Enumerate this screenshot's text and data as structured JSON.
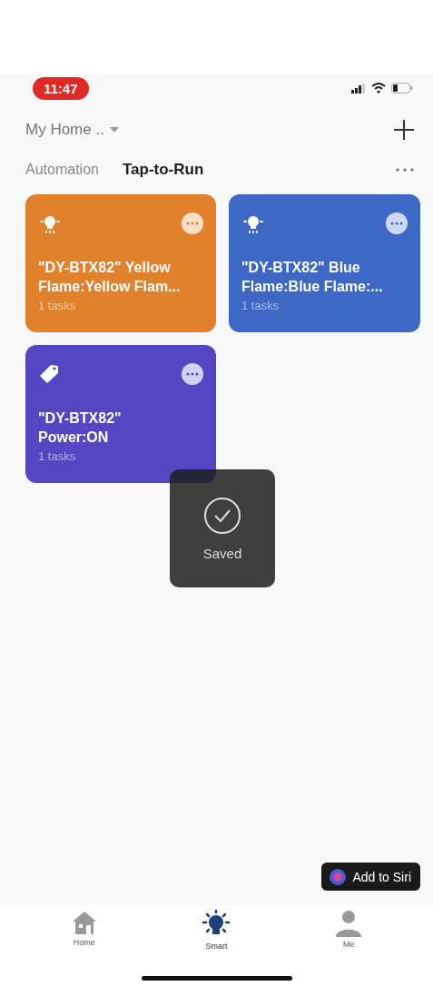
{
  "status_bar": {
    "time": "11:47"
  },
  "header": {
    "home": "My Home .."
  },
  "tabs": [
    {
      "label": "Automation",
      "selected": false
    },
    {
      "label": "Tap-to-Run",
      "selected": true
    }
  ],
  "scenes": [
    {
      "kind": "bulb",
      "color": "#e2812c",
      "title": "\"DY-BTX82\" Yellow Flame:Yellow Flam...",
      "tasks": "1 tasks"
    },
    {
      "kind": "bulb",
      "color": "#3e68c6",
      "title": "\"DY-BTX82\" Blue Flame:Blue Flame:...",
      "tasks": "1 tasks"
    },
    {
      "kind": "tag",
      "color": "#5546c4",
      "title": "\"DY-BTX82\" Power:ON",
      "tasks": "1 tasks"
    }
  ],
  "toast": {
    "message": "Saved"
  },
  "siri_button": "Add to Siri",
  "tab_bar": [
    {
      "kind": "home",
      "label": "Home",
      "selected": false
    },
    {
      "kind": "smart",
      "label": "Smart",
      "selected": true
    },
    {
      "kind": "me",
      "label": "Me",
      "selected": false
    }
  ]
}
